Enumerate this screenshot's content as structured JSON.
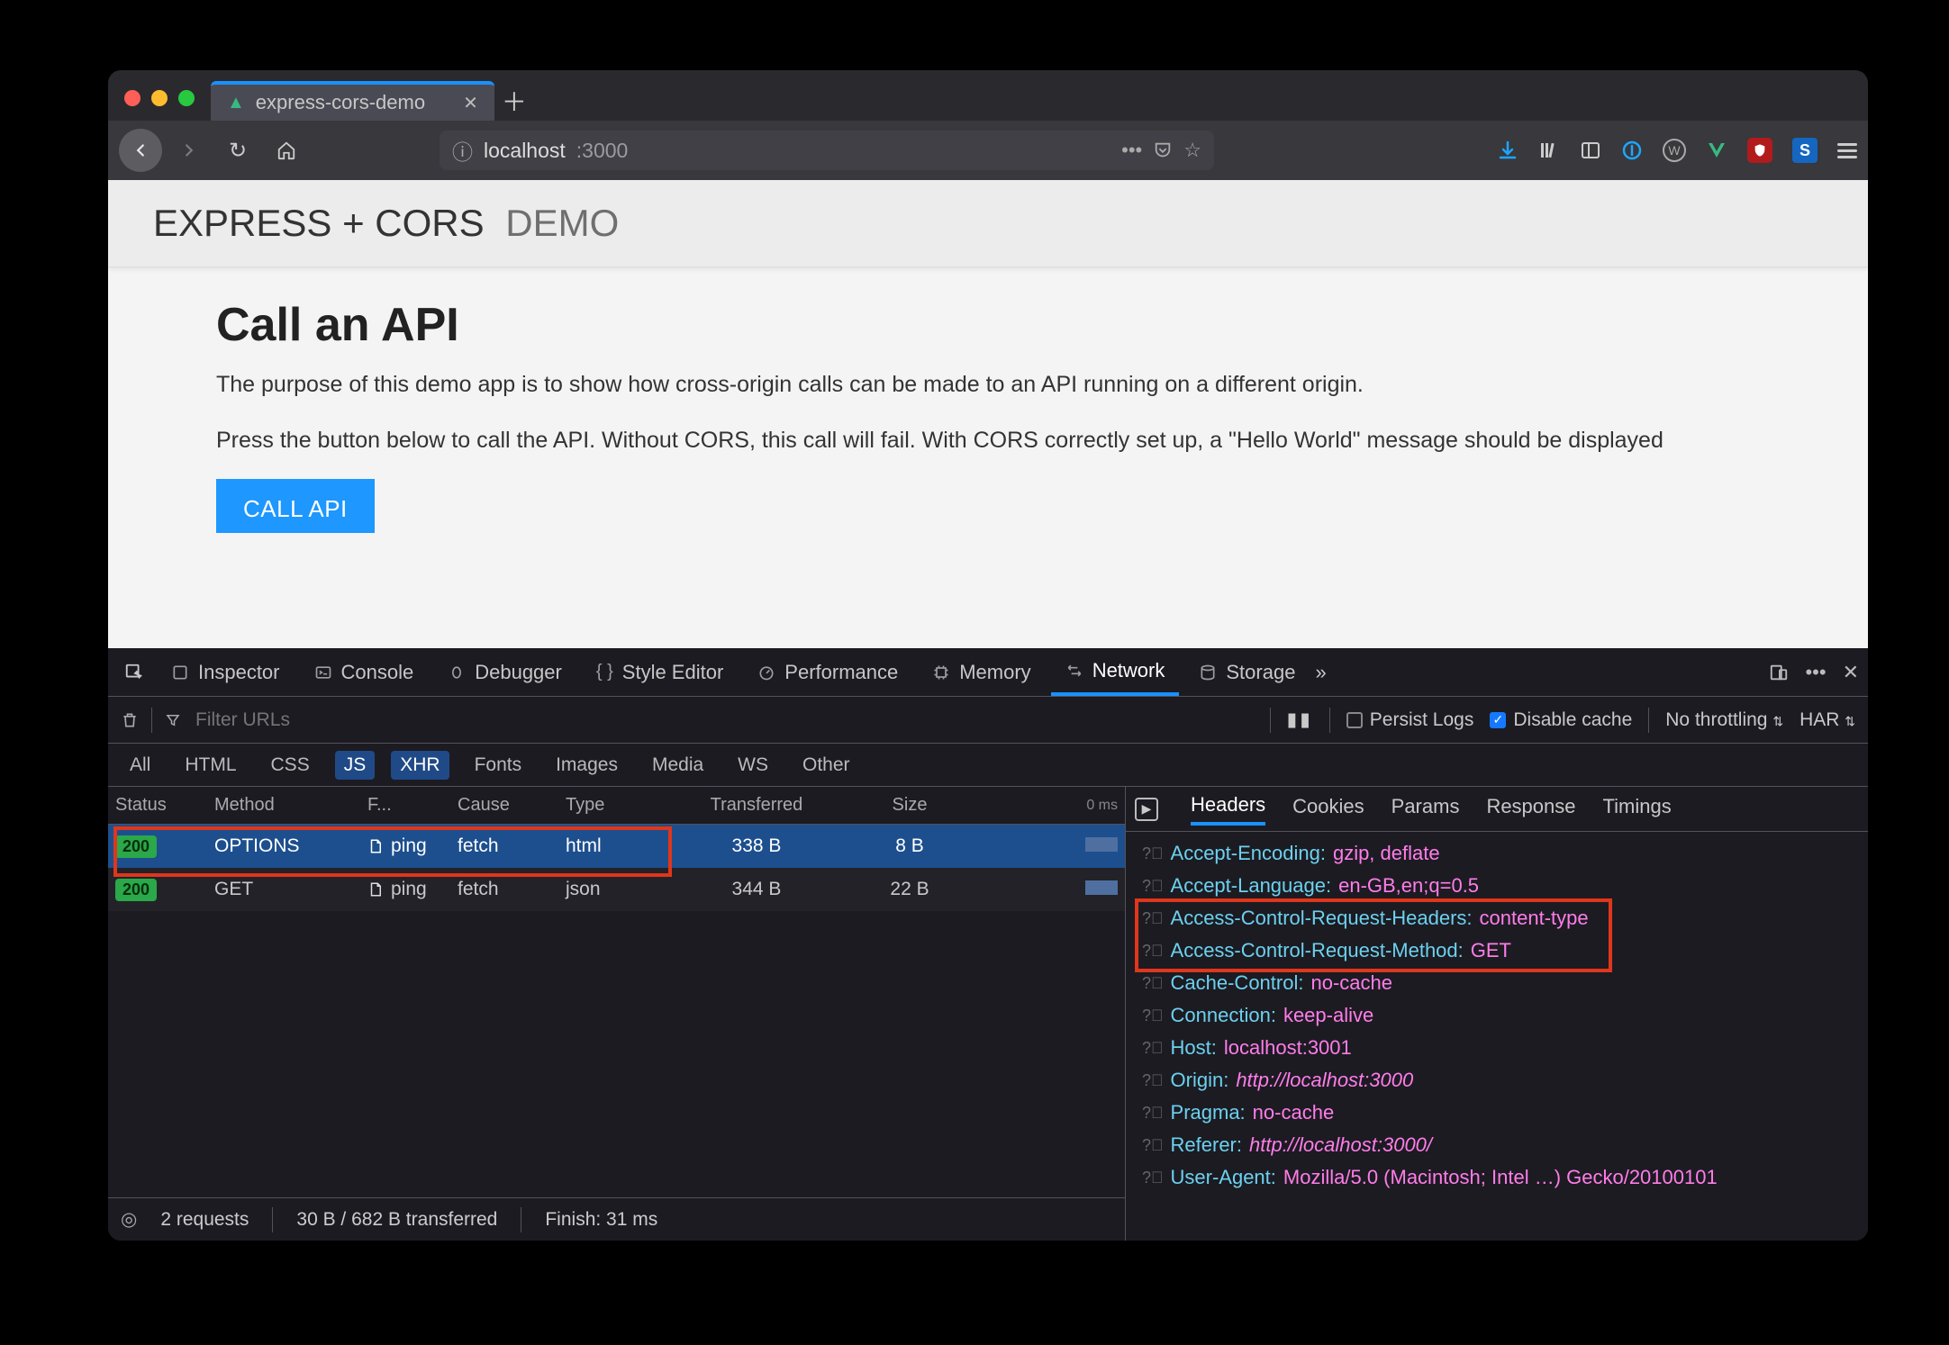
{
  "browser": {
    "tab_title": "express-cors-demo",
    "url_host": "localhost",
    "url_port": ":3000"
  },
  "page": {
    "header_strong": "EXPRESS + CORS",
    "header_light": "DEMO",
    "h2": "Call an API",
    "p1": "The purpose of this demo app is to show how cross-origin calls can be made to an API running on a different origin.",
    "p2": "Press the button below to call the API. Without CORS, this call will fail. With CORS correctly set up, a \"Hello World\" message should be displayed",
    "cta": "CALL API"
  },
  "dev": {
    "tabs": [
      "Inspector",
      "Console",
      "Debugger",
      "Style Editor",
      "Performance",
      "Memory",
      "Network",
      "Storage"
    ],
    "active_tab": "Network",
    "filter_placeholder": "Filter URLs",
    "persist_label": "Persist Logs",
    "disable_cache_label": "Disable cache",
    "throttle": "No throttling",
    "har": "HAR",
    "type_filters": [
      "All",
      "HTML",
      "CSS",
      "JS",
      "XHR",
      "Fonts",
      "Images",
      "Media",
      "WS",
      "Other"
    ],
    "type_selected": [
      "JS",
      "XHR"
    ],
    "cols": {
      "status": "Status",
      "method": "Method",
      "file": "F...",
      "cause": "Cause",
      "type": "Type",
      "transferred": "Transferred",
      "size": "Size",
      "wf": "0 ms"
    },
    "rows": [
      {
        "status": "200",
        "method": "OPTIONS",
        "file": "ping",
        "cause": "fetch",
        "type": "html",
        "transferred": "338 B",
        "size": "8 B",
        "selected": true
      },
      {
        "status": "200",
        "method": "GET",
        "file": "ping",
        "cause": "fetch",
        "type": "json",
        "transferred": "344 B",
        "size": "22 B",
        "selected": false
      }
    ],
    "footer": {
      "requests": "2 requests",
      "transferred": "30 B / 682 B transferred",
      "finish": "Finish: 31 ms"
    },
    "detail_tabs": [
      "Headers",
      "Cookies",
      "Params",
      "Response",
      "Timings"
    ],
    "detail_active": "Headers",
    "headers": [
      {
        "k": "Accept-Encoding:",
        "v": "gzip, deflate"
      },
      {
        "k": "Accept-Language:",
        "v": "en-GB,en;q=0.5"
      },
      {
        "k": "Access-Control-Request-Headers:",
        "v": "content-type"
      },
      {
        "k": "Access-Control-Request-Method:",
        "v": "GET"
      },
      {
        "k": "Cache-Control:",
        "v": "no-cache"
      },
      {
        "k": "Connection:",
        "v": "keep-alive"
      },
      {
        "k": "Host:",
        "v": "localhost:3001"
      },
      {
        "k": "Origin:",
        "v": "http://localhost:3000",
        "italic": true
      },
      {
        "k": "Pragma:",
        "v": "no-cache"
      },
      {
        "k": "Referer:",
        "v": "http://localhost:3000/",
        "italic": true
      },
      {
        "k": "User-Agent:",
        "v": "Mozilla/5.0 (Macintosh; Intel …) Gecko/20100101"
      }
    ]
  }
}
